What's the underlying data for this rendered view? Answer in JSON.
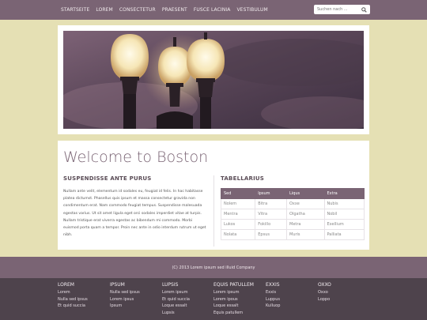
{
  "nav": {
    "items": [
      "STARTSEITE",
      "LOREM",
      "CONSECTETUR",
      "PRAESENT",
      "FUSCE LACINIA",
      "VESTIBULUM"
    ]
  },
  "search": {
    "placeholder": "Suchen nach ...",
    "icon": "search-icon"
  },
  "colors": {
    "bg": "#e5e0b4",
    "accent": "#7a6474",
    "footer": "#4e434c"
  },
  "main": {
    "title": "Welcome to Boston",
    "left": {
      "heading": "SUSPENDISSE ANTE PURUS",
      "text": "Nullam ante velit, elementum id sodales eu, feugiat id felis. In hac habitasse platea dictumst. Phasellus quis ipsum et massa consectetur gravida non condimentum erat. Nam commodo feugiat tempus. Suspendisse malesuada egestas varius. Ut sit amet ligula eget orci sodales imperdiet vitae at turpis. Nullam tristique erat viverra egestas ac bibendum mi commodo. Morbi euismod porta quam a tempor. Proin nec ante in odio interdum rutrum ut eget nibh."
    },
    "right": {
      "heading": "TABELLARIUS",
      "columns": [
        "Sed",
        "Ipsum",
        "Liqus",
        "Extra"
      ],
      "rows": [
        [
          "Nolem",
          "Bitra",
          "Oxxe",
          "Nubis"
        ],
        [
          "Mentra",
          "Vitra",
          "Olgatha",
          "Nobil"
        ],
        [
          "Lukos",
          "Fokillo",
          "Metra",
          "Exellium"
        ],
        [
          "Nolata",
          "Epsus",
          "Muris",
          "Palliata"
        ]
      ]
    }
  },
  "copyright": "(C) 2013 Lorem ipsum sed illuid Company",
  "footer": {
    "columns": [
      {
        "heading": "LOREM",
        "links": [
          "Lorem",
          "Nulla sed ipsus",
          "Et quid succia"
        ]
      },
      {
        "heading": "IPSUM",
        "links": [
          "Nulla sed ipsus",
          "Lorem ipsus",
          "Ipsum"
        ]
      },
      {
        "heading": "LUPSIS",
        "links": [
          "Lorem ipsum",
          "Et quid succia",
          "Loque essalt",
          "Lupsis"
        ]
      },
      {
        "heading": "EQUIS PATULLEM",
        "links": [
          "Lorem ipsum",
          "Lorem ipous",
          "Loque essalt",
          "Equis patullem"
        ]
      },
      {
        "heading": "EXXIS",
        "links": [
          "Exxis",
          "Luppus",
          "Kulluop"
        ]
      },
      {
        "heading": "OXXO",
        "links": [
          "Oxxo",
          "Loppo"
        ]
      }
    ]
  }
}
